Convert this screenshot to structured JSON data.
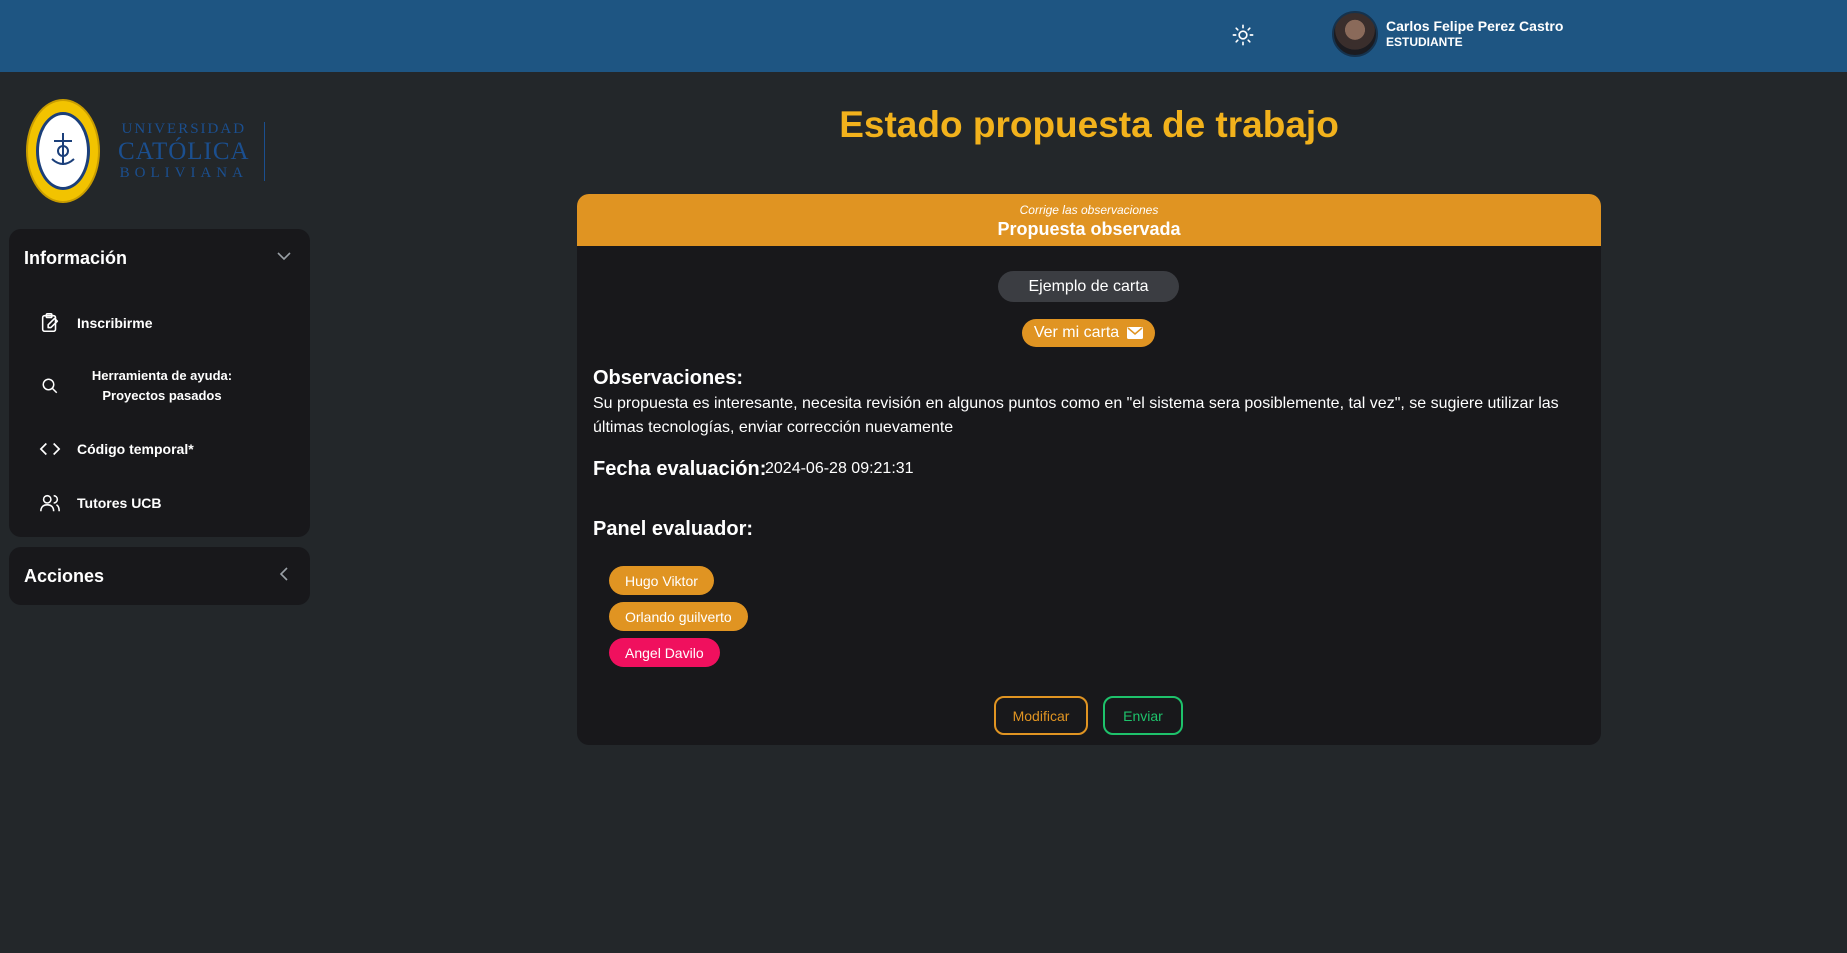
{
  "colors": {
    "topbar": "#1e5582",
    "background": "#23272a",
    "panel": "#18181b",
    "accent": "#e09422",
    "title": "#f2b21c",
    "danger": "#f0105e",
    "success": "#1ec26b"
  },
  "header": {
    "theme_icon": "sun-icon",
    "user_name": "Carlos Felipe Perez Castro",
    "user_role": "ESTUDIANTE"
  },
  "logo": {
    "line1": "UNIVERSIDAD",
    "line2": "CATÓLICA",
    "line3": "BOLIVIANA"
  },
  "sidebar": {
    "info_title": "Información",
    "items": [
      {
        "label": "Inscribirme",
        "icon": "clipboard-edit-icon"
      },
      {
        "label": "Herramienta de ayuda: Proyectos pasados",
        "icon": "search-icon"
      },
      {
        "label": "Código temporal*",
        "icon": "code-icon"
      },
      {
        "label": "Tutores UCB",
        "icon": "users-icon"
      }
    ],
    "actions_title": "Acciones"
  },
  "main": {
    "title": "Estado propuesta de trabajo",
    "card": {
      "subtitle": "Corrige las observaciones",
      "status": "Propuesta observada",
      "example_button": "Ejemplo de carta",
      "letter_button": "Ver mi carta",
      "observations_label": "Observaciones:",
      "observations_text": "Su propuesta es interesante, necesita revisión en algunos puntos como en \"el sistema sera posiblemente, tal vez\", se sugiere utilizar las últimas tecnologías, enviar corrección nuevamente",
      "date_label": "Fecha evaluación:",
      "date_value": "2024-06-28 09:21:31",
      "panel_label": "Panel evaluador:",
      "evaluators": [
        {
          "name": "Hugo Viktor",
          "color": "#e09422"
        },
        {
          "name": "Orlando guilverto",
          "color": "#e09422"
        },
        {
          "name": "Angel Davilo",
          "color": "#f0105e"
        }
      ],
      "modify_button": "Modificar",
      "send_button": "Enviar"
    }
  }
}
